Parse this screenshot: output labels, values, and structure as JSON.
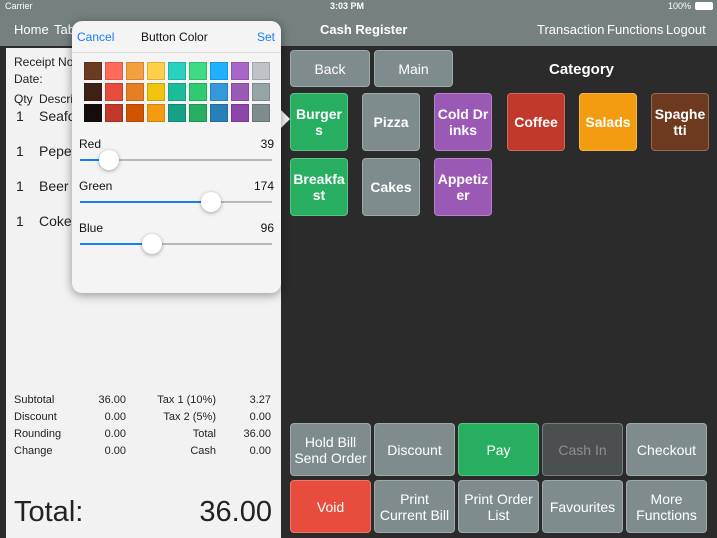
{
  "status": {
    "carrier": "Carrier",
    "time": "3:03 PM",
    "battery": "100%"
  },
  "nav": {
    "home": "Home",
    "tables": "Tables",
    "title": "Cash Register",
    "transaction": "Transaction",
    "functions": "Functions",
    "logout": "Logout"
  },
  "receipt": {
    "receipt_no": "Receipt No",
    "date": "Date:",
    "qty": "Qty",
    "desc": "Description",
    "items": [
      {
        "qty": "1",
        "name": "Seafood"
      },
      {
        "qty": "1",
        "name": "Peperoni"
      },
      {
        "qty": "1",
        "name": "Beer"
      },
      {
        "qty": "1",
        "name": "Coke"
      }
    ],
    "summary": [
      [
        "Subtotal",
        "36.00",
        "Tax 1 (10%)",
        "3.27"
      ],
      [
        "Discount",
        "0.00",
        "Tax 2 (5%)",
        "0.00"
      ],
      [
        "Rounding",
        "0.00",
        "Total",
        "36.00"
      ],
      [
        "Change",
        "0.00",
        "Cash",
        "0.00"
      ]
    ],
    "total_label": "Total:",
    "total_value": "36.00"
  },
  "popover": {
    "cancel": "Cancel",
    "title": "Button Color",
    "set": "Set",
    "swatches": [
      [
        "#6b3a22",
        "#ff6b5b",
        "#f3a03e",
        "#ffcf4a",
        "#2ad0c0",
        "#3ddc84",
        "#1fb0ff",
        "#a866c8",
        "#bdc3c7"
      ],
      [
        "#3d2114",
        "#e74c3c",
        "#e67e22",
        "#f1c40f",
        "#1abc9c",
        "#2ecc71",
        "#3498db",
        "#9b59b6",
        "#95a5a6"
      ],
      [
        "#150d0b",
        "#c0392b",
        "#d35400",
        "#f39c12",
        "#16a085",
        "#27ae60",
        "#2980b9",
        "#8e44ad",
        "#7f8c8d"
      ]
    ],
    "sliders": [
      {
        "label": "Red",
        "value": "39",
        "fraction": 0.153
      },
      {
        "label": "Green",
        "value": "174",
        "fraction": 0.682
      },
      {
        "label": "Blue",
        "value": "96",
        "fraction": 0.376
      }
    ]
  },
  "main": {
    "back": "Back",
    "main": "Main",
    "category_label": "Category",
    "categories": [
      {
        "label": "Burgers",
        "color": "#27ae60"
      },
      {
        "label": "Pizza",
        "color": "#7f8c8d"
      },
      {
        "label": "Cold Drinks",
        "color": "#9b59b6"
      },
      {
        "label": "Coffee",
        "color": "#c0392b"
      },
      {
        "label": "Salads",
        "color": "#f39c12"
      },
      {
        "label": "Spaghetti",
        "color": "#6e3a1f"
      },
      {
        "label": "Breakfast",
        "color": "#27ae60"
      },
      {
        "label": "Cakes",
        "color": "#7f8c8d"
      },
      {
        "label": "Appetizer",
        "color": "#9b59b6"
      }
    ],
    "actions": [
      {
        "label": "Hold Bill Send Order",
        "color": "#7f8c8d"
      },
      {
        "label": "Discount",
        "color": "#7f8c8d"
      },
      {
        "label": "Pay",
        "color": "#27ae60"
      },
      {
        "label": "Cash In",
        "color": "#4a5050"
      },
      {
        "label": "Checkout",
        "color": "#7f8c8d"
      },
      {
        "label": "Void",
        "color": "#e74c3c"
      },
      {
        "label": "Print Current Bill",
        "color": "#7f8c8d"
      },
      {
        "label": "Print Order List",
        "color": "#7f8c8d"
      },
      {
        "label": "Favourites",
        "color": "#7f8c8d"
      },
      {
        "label": "More Functions",
        "color": "#7f8c8d"
      }
    ]
  }
}
